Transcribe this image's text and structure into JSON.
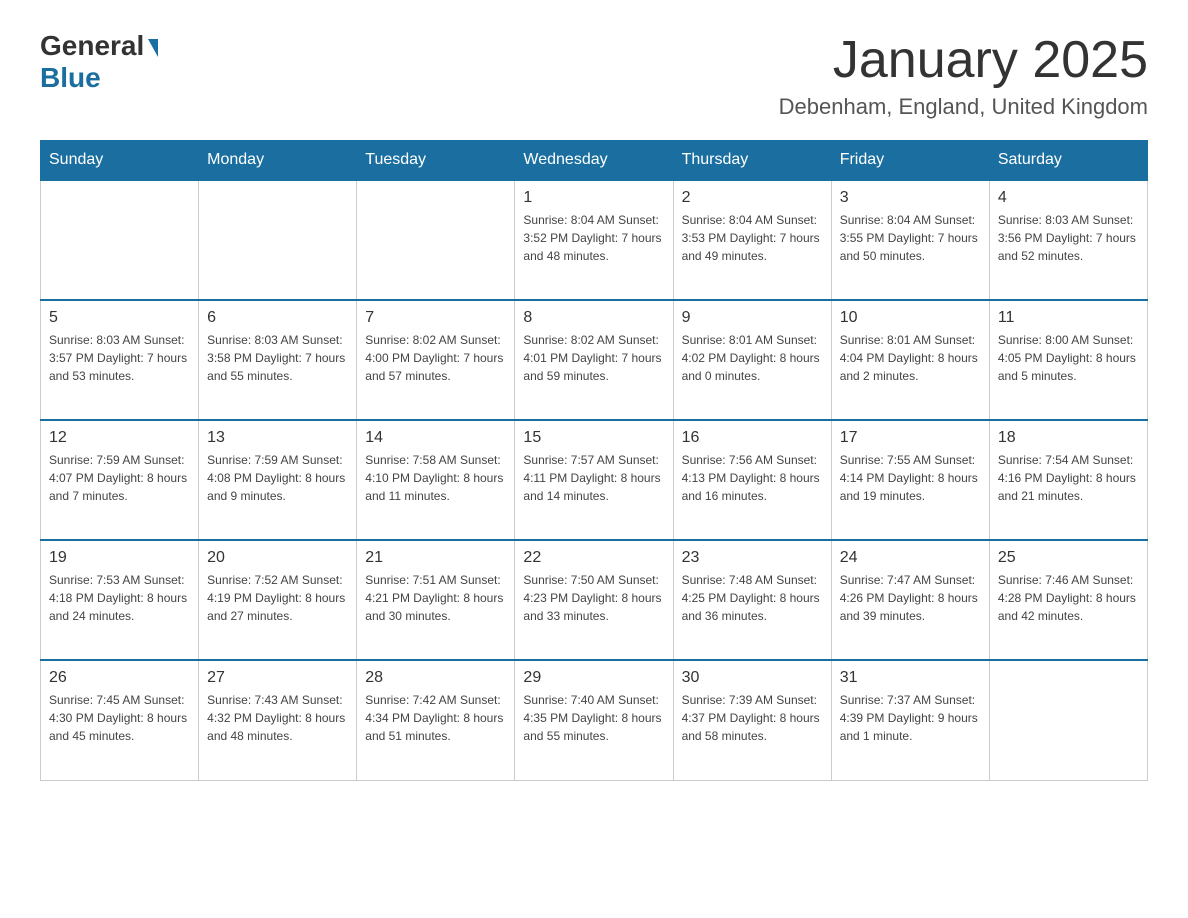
{
  "header": {
    "logo_general": "General",
    "logo_blue": "Blue",
    "title": "January 2025",
    "subtitle": "Debenham, England, United Kingdom"
  },
  "days_of_week": [
    "Sunday",
    "Monday",
    "Tuesday",
    "Wednesday",
    "Thursday",
    "Friday",
    "Saturday"
  ],
  "weeks": [
    [
      {
        "day": "",
        "info": ""
      },
      {
        "day": "",
        "info": ""
      },
      {
        "day": "",
        "info": ""
      },
      {
        "day": "1",
        "info": "Sunrise: 8:04 AM\nSunset: 3:52 PM\nDaylight: 7 hours\nand 48 minutes."
      },
      {
        "day": "2",
        "info": "Sunrise: 8:04 AM\nSunset: 3:53 PM\nDaylight: 7 hours\nand 49 minutes."
      },
      {
        "day": "3",
        "info": "Sunrise: 8:04 AM\nSunset: 3:55 PM\nDaylight: 7 hours\nand 50 minutes."
      },
      {
        "day": "4",
        "info": "Sunrise: 8:03 AM\nSunset: 3:56 PM\nDaylight: 7 hours\nand 52 minutes."
      }
    ],
    [
      {
        "day": "5",
        "info": "Sunrise: 8:03 AM\nSunset: 3:57 PM\nDaylight: 7 hours\nand 53 minutes."
      },
      {
        "day": "6",
        "info": "Sunrise: 8:03 AM\nSunset: 3:58 PM\nDaylight: 7 hours\nand 55 minutes."
      },
      {
        "day": "7",
        "info": "Sunrise: 8:02 AM\nSunset: 4:00 PM\nDaylight: 7 hours\nand 57 minutes."
      },
      {
        "day": "8",
        "info": "Sunrise: 8:02 AM\nSunset: 4:01 PM\nDaylight: 7 hours\nand 59 minutes."
      },
      {
        "day": "9",
        "info": "Sunrise: 8:01 AM\nSunset: 4:02 PM\nDaylight: 8 hours\nand 0 minutes."
      },
      {
        "day": "10",
        "info": "Sunrise: 8:01 AM\nSunset: 4:04 PM\nDaylight: 8 hours\nand 2 minutes."
      },
      {
        "day": "11",
        "info": "Sunrise: 8:00 AM\nSunset: 4:05 PM\nDaylight: 8 hours\nand 5 minutes."
      }
    ],
    [
      {
        "day": "12",
        "info": "Sunrise: 7:59 AM\nSunset: 4:07 PM\nDaylight: 8 hours\nand 7 minutes."
      },
      {
        "day": "13",
        "info": "Sunrise: 7:59 AM\nSunset: 4:08 PM\nDaylight: 8 hours\nand 9 minutes."
      },
      {
        "day": "14",
        "info": "Sunrise: 7:58 AM\nSunset: 4:10 PM\nDaylight: 8 hours\nand 11 minutes."
      },
      {
        "day": "15",
        "info": "Sunrise: 7:57 AM\nSunset: 4:11 PM\nDaylight: 8 hours\nand 14 minutes."
      },
      {
        "day": "16",
        "info": "Sunrise: 7:56 AM\nSunset: 4:13 PM\nDaylight: 8 hours\nand 16 minutes."
      },
      {
        "day": "17",
        "info": "Sunrise: 7:55 AM\nSunset: 4:14 PM\nDaylight: 8 hours\nand 19 minutes."
      },
      {
        "day": "18",
        "info": "Sunrise: 7:54 AM\nSunset: 4:16 PM\nDaylight: 8 hours\nand 21 minutes."
      }
    ],
    [
      {
        "day": "19",
        "info": "Sunrise: 7:53 AM\nSunset: 4:18 PM\nDaylight: 8 hours\nand 24 minutes."
      },
      {
        "day": "20",
        "info": "Sunrise: 7:52 AM\nSunset: 4:19 PM\nDaylight: 8 hours\nand 27 minutes."
      },
      {
        "day": "21",
        "info": "Sunrise: 7:51 AM\nSunset: 4:21 PM\nDaylight: 8 hours\nand 30 minutes."
      },
      {
        "day": "22",
        "info": "Sunrise: 7:50 AM\nSunset: 4:23 PM\nDaylight: 8 hours\nand 33 minutes."
      },
      {
        "day": "23",
        "info": "Sunrise: 7:48 AM\nSunset: 4:25 PM\nDaylight: 8 hours\nand 36 minutes."
      },
      {
        "day": "24",
        "info": "Sunrise: 7:47 AM\nSunset: 4:26 PM\nDaylight: 8 hours\nand 39 minutes."
      },
      {
        "day": "25",
        "info": "Sunrise: 7:46 AM\nSunset: 4:28 PM\nDaylight: 8 hours\nand 42 minutes."
      }
    ],
    [
      {
        "day": "26",
        "info": "Sunrise: 7:45 AM\nSunset: 4:30 PM\nDaylight: 8 hours\nand 45 minutes."
      },
      {
        "day": "27",
        "info": "Sunrise: 7:43 AM\nSunset: 4:32 PM\nDaylight: 8 hours\nand 48 minutes."
      },
      {
        "day": "28",
        "info": "Sunrise: 7:42 AM\nSunset: 4:34 PM\nDaylight: 8 hours\nand 51 minutes."
      },
      {
        "day": "29",
        "info": "Sunrise: 7:40 AM\nSunset: 4:35 PM\nDaylight: 8 hours\nand 55 minutes."
      },
      {
        "day": "30",
        "info": "Sunrise: 7:39 AM\nSunset: 4:37 PM\nDaylight: 8 hours\nand 58 minutes."
      },
      {
        "day": "31",
        "info": "Sunrise: 7:37 AM\nSunset: 4:39 PM\nDaylight: 9 hours\nand 1 minute."
      },
      {
        "day": "",
        "info": ""
      }
    ]
  ]
}
